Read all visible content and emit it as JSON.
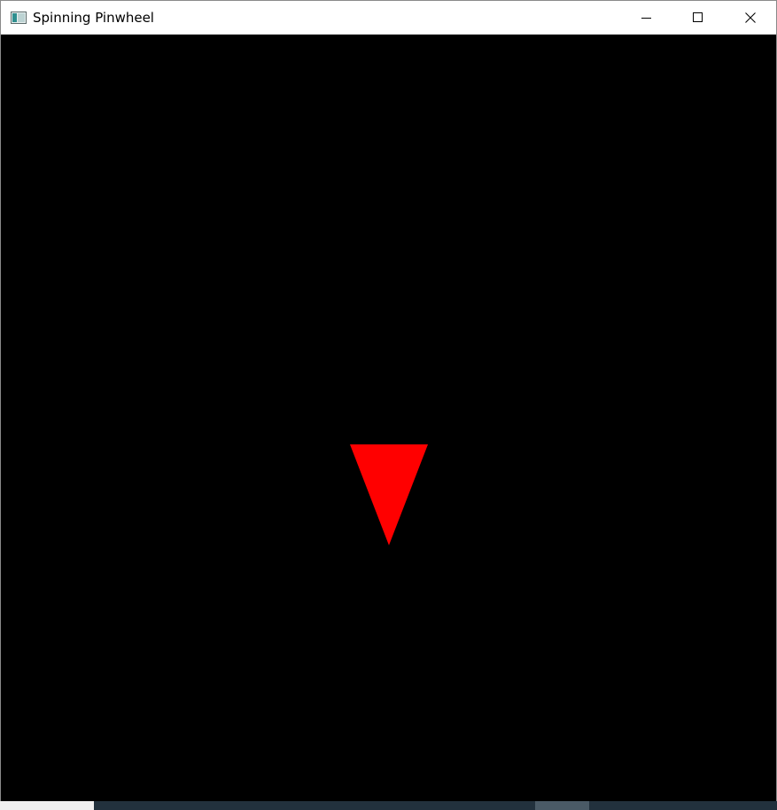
{
  "window": {
    "title": "Spinning Pinwheel",
    "icon": "app-window-icon"
  },
  "caption_buttons": {
    "minimize_icon": "minimize-icon",
    "maximize_icon": "maximize-icon",
    "close_icon": "close-icon"
  },
  "scene": {
    "background_color": "#000000",
    "shape": "triangle",
    "shape_color": "#ff0000"
  },
  "taskbar": {
    "color": "#22313d"
  }
}
